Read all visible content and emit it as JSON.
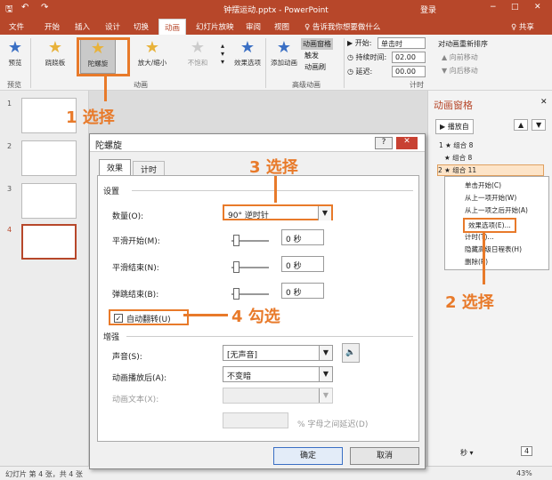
{
  "titlebar": {
    "title": "钟摆运动.pptx - PowerPoint",
    "login": "登录",
    "min": "−",
    "max": "□",
    "close": "✕"
  },
  "tabs": [
    "文件",
    "开始",
    "插入",
    "设计",
    "切换",
    "动画",
    "幻灯片放映",
    "审阅",
    "视图"
  ],
  "tell_me": "♀ 告诉我你想要做什么",
  "share": "♀ 共享",
  "ribbon": {
    "preview": "预览",
    "animations": [
      "跷跷板",
      "陀螺旋",
      "放大/缩小",
      "不饱和"
    ],
    "effect_options": "效果选项",
    "add_animation": "添加动画",
    "anim_pane_btn": "动画窗格",
    "trigger": "触发",
    "anim_painter": "动画刷",
    "start_label": "▶ 开始:",
    "start_value": "单击时",
    "duration_label": "◷ 持续时间:",
    "duration_value": "02.00",
    "delay_label": "◷ 延迟:",
    "delay_value": "00.00",
    "reorder": "对动画重新排序",
    "move_earlier": "▲ 向前移动",
    "move_later": "▼ 向后移动",
    "groups": {
      "preview": "预览",
      "animation": "动画",
      "advanced": "高级动画",
      "timing": "计时"
    }
  },
  "thumbnails": [
    {
      "num": "1"
    },
    {
      "num": "2"
    },
    {
      "num": "3"
    },
    {
      "num": "4"
    }
  ],
  "pane": {
    "title": "动画窗格",
    "play": "▶ 播放自",
    "items": [
      "1 ★ 组合 8",
      "★ 组合 8",
      "2 ★ 组合 11"
    ],
    "menu": [
      "单击开始(C)",
      "从上一项开始(W)",
      "从上一项之后开始(A)",
      "效果选项(E)...",
      "计时(T)...",
      "隐藏高级日程表(H)",
      "删除(R)"
    ],
    "seconds": "秒 ▾",
    "page": "4"
  },
  "dialog": {
    "title": "陀螺旋",
    "help": "?",
    "close": "✕",
    "tabs": [
      "效果",
      "计时"
    ],
    "settings": "设置",
    "amount_label": "数量(O):",
    "amount_value": "90° 逆时针",
    "smooth_start": "平滑开始(M):",
    "smooth_end": "平滑结束(N):",
    "bounce_end": "弹跳结束(B):",
    "sec_value": "0 秒",
    "auto_reverse": "自动翻转(U)",
    "enhance": "增强",
    "sound_label": "声音(S):",
    "sound_value": "[无声音]",
    "after_label": "动画播放后(A):",
    "after_value": "不变暗",
    "text_label": "动画文本(X):",
    "delay_pct": "% 字母之间延迟(D)",
    "ok": "确定",
    "cancel": "取消"
  },
  "callouts": {
    "c1": "1 选择",
    "c2": "2 选择",
    "c3": "3 选择",
    "c4": "4 勾选"
  },
  "status": {
    "slide": "幻灯片 第 4 张，共 4 张",
    "zoom": "43%"
  },
  "colors": {
    "accent": "#b7472a",
    "callout": "#e87a2a"
  }
}
